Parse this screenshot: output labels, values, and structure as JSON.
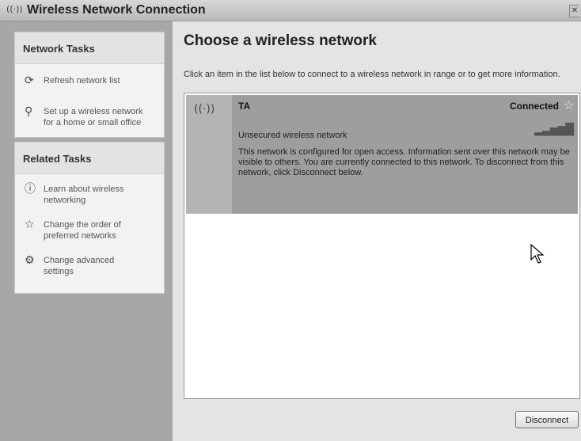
{
  "window": {
    "title": "Wireless Network Connection",
    "title_icon": "wireless-antenna-icon",
    "close_glyph": "✕"
  },
  "sidebar": {
    "network_tasks": {
      "header": "Network Tasks",
      "items": [
        {
          "label": "Refresh network list",
          "icon": "refresh-icon"
        },
        {
          "label_line1": "Set up a wireless network",
          "label_line2": "for a home or small office",
          "icon": "setup-wireless-icon"
        }
      ]
    },
    "related_tasks": {
      "header": "Related Tasks",
      "items": [
        {
          "label_line1": "Learn about wireless",
          "label_line2": "networking",
          "icon": "info-icon"
        },
        {
          "label_line1": "Change the order of",
          "label_line2": "preferred networks",
          "icon": "star-icon"
        },
        {
          "label_line1": "Change advanced",
          "label_line2": "settings",
          "icon": "settings-icon"
        }
      ]
    }
  },
  "main": {
    "title": "Choose a wireless network",
    "description": "Click an item in the list below to connect to a wireless network in range or to get more information.",
    "networks": [
      {
        "ssid": "TA",
        "status": "Connected",
        "security": "Unsecured wireless network",
        "signal_icon": "signal-strength-icon",
        "detail": "This network is configured for open access. Information sent over this network may be visible to others. You are currently connected to this network. To disconnect from this network, click Disconnect below."
      }
    ],
    "disconnect_label": "Disconnect"
  }
}
